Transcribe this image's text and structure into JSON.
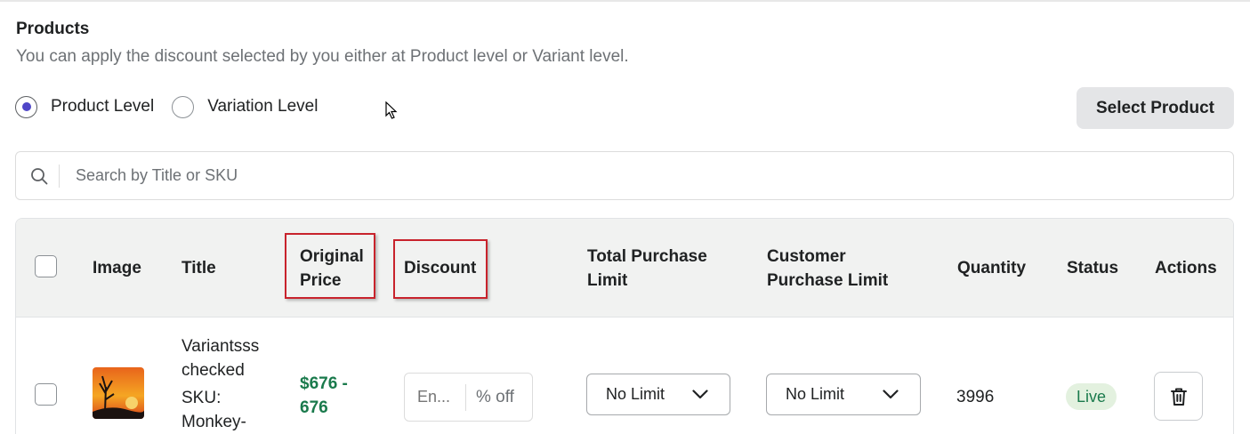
{
  "section": {
    "title": "Products",
    "description": "You can apply the discount selected by you either at Product level or Variant level."
  },
  "level_options": [
    {
      "label": "Product Level",
      "selected": true
    },
    {
      "label": "Variation Level",
      "selected": false
    }
  ],
  "select_product_label": "Select Product",
  "search": {
    "placeholder": "Search by Title or SKU",
    "value": ""
  },
  "table": {
    "columns": {
      "image": "Image",
      "title": "Title",
      "original_price_line1": "Original",
      "original_price_line2": "Price",
      "discount": "Discount",
      "total_limit_line1": "Total Purchase",
      "total_limit_line2": "Limit",
      "customer_limit_line1": "Customer",
      "customer_limit_line2": "Purchase Limit",
      "quantity": "Quantity",
      "status": "Status",
      "actions": "Actions"
    },
    "rows": [
      {
        "title_line1": "Variantsss",
        "title_line2": "checked",
        "sku_line1": "SKU:",
        "sku_line2": "Monkey-",
        "price_line1": "$676 -",
        "price_line2": "676",
        "discount_placeholder": "En...",
        "discount_suffix": "% off",
        "total_purchase_limit": "No Limit",
        "customer_purchase_limit": "No Limit",
        "quantity": "3996",
        "status": "Live"
      }
    ]
  },
  "colors": {
    "accent": "#4f46c8",
    "price_green": "#1a7a4c",
    "badge_bg": "#e3f1df",
    "highlight_red": "#c8232c"
  },
  "icons": [
    "search-icon",
    "chevron-down-icon",
    "trash-icon",
    "cursor-icon"
  ]
}
